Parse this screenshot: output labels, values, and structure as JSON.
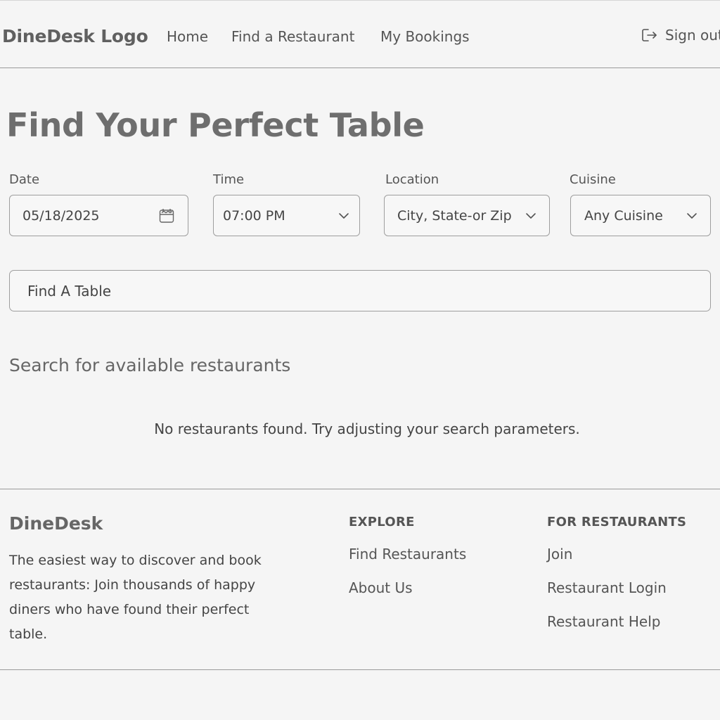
{
  "header": {
    "logo": "DineDesk Logo",
    "nav": {
      "home": "Home",
      "find": "Find a Restaurant",
      "bookings": "My Bookings"
    },
    "sign_out": "Sign out",
    "sign_out_icon": "sign-out-icon"
  },
  "hero": {
    "title": "Find Your Perfect Table"
  },
  "search": {
    "date": {
      "label": "Date",
      "value": "05/18/2025",
      "icon": "calendar-icon"
    },
    "time": {
      "label": "Time",
      "value": "07:00 PM",
      "icon": "chevron-down-icon"
    },
    "location": {
      "label": "Location",
      "value": "City, State-or Zip",
      "icon": "chevron-down-icon"
    },
    "cuisine": {
      "label": "Cuisine",
      "value": "Any Cuisine",
      "icon": "chevron-down-icon"
    },
    "submit_label": "Find A Table"
  },
  "results": {
    "heading": "Search for available restaurants",
    "empty_message": "No restaurants found. Try adjusting your search parameters."
  },
  "footer": {
    "brand": "DineDesk",
    "tagline": "The easiest way to discover and book restaurants: Join thousands of happy diners who have found  their perfect table.",
    "explore": {
      "title": "EXPLORE",
      "links": [
        "Find Restaurants",
        "About Us"
      ]
    },
    "for_restaurants": {
      "title": "FOR RESTAURANTS",
      "links": [
        "Join",
        "Restaurant Login",
        "Restaurant Help"
      ]
    }
  }
}
